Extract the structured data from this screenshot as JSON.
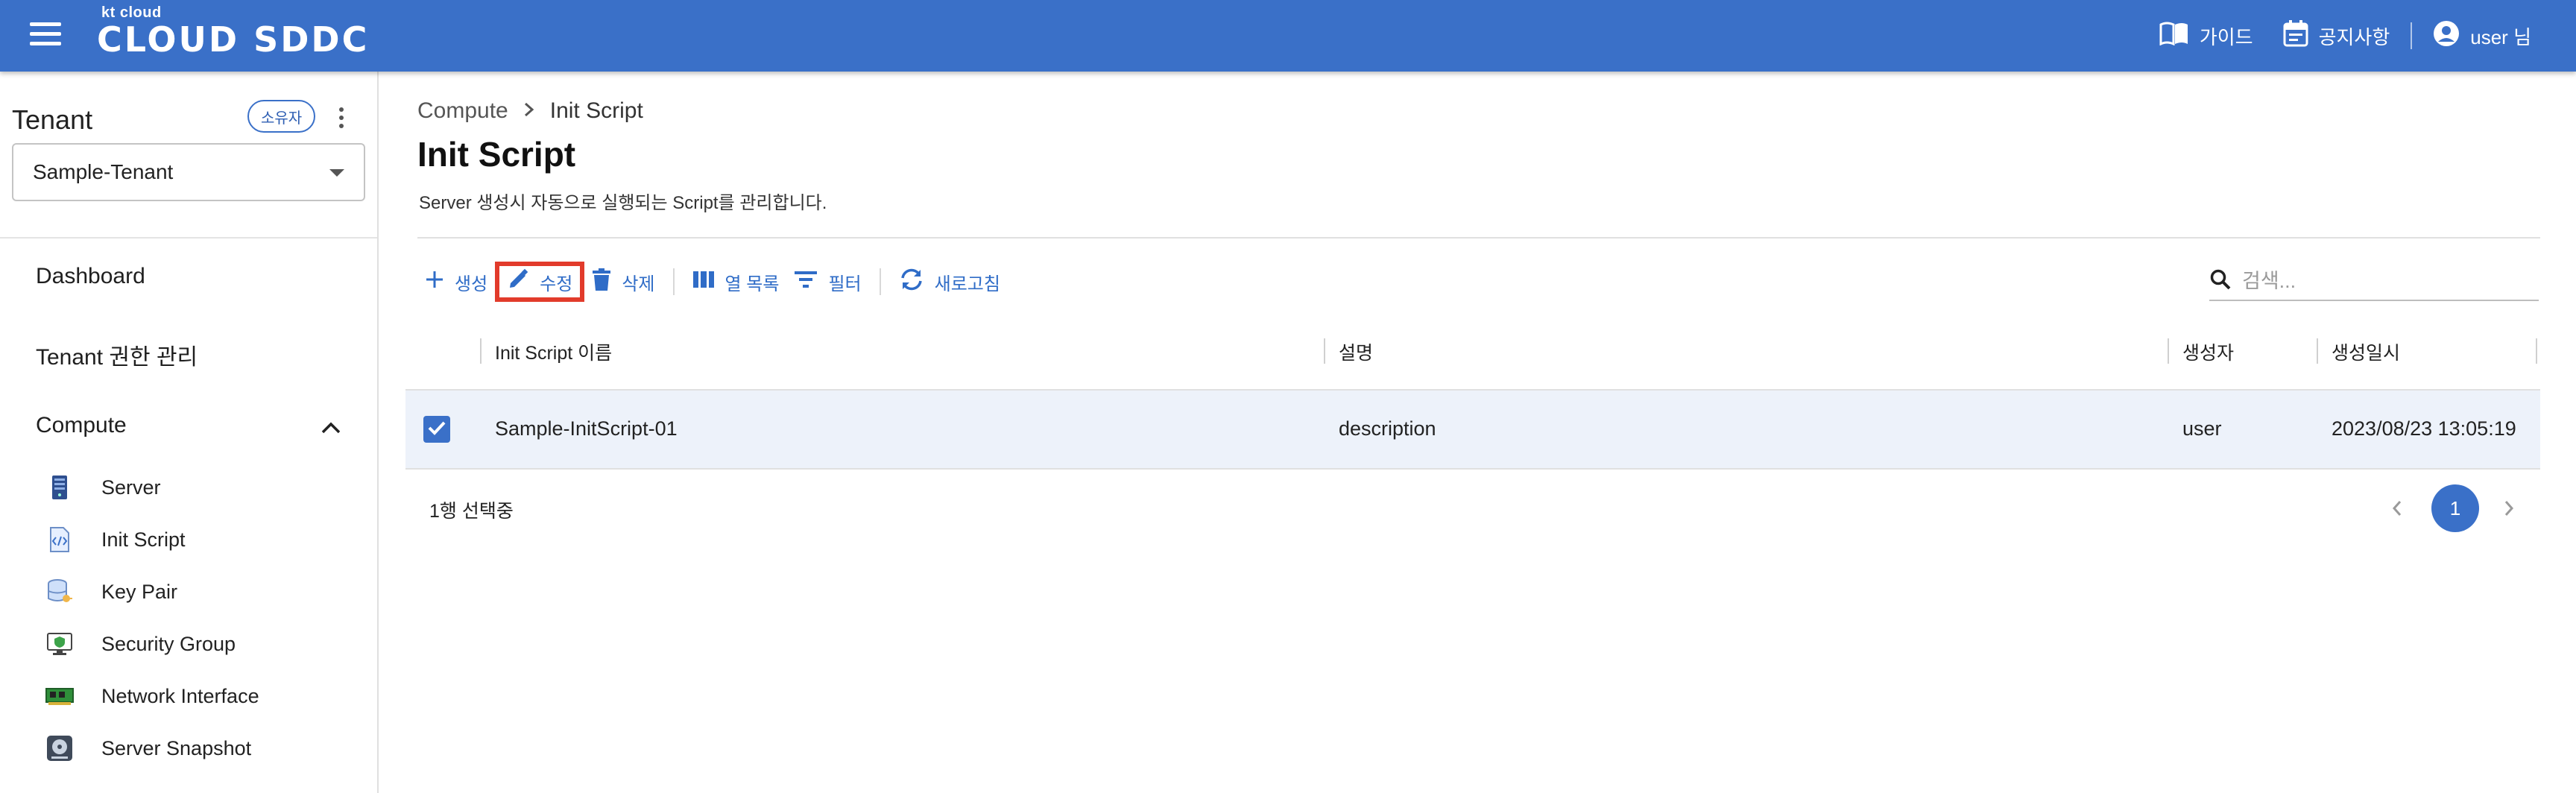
{
  "header": {
    "logo_small": "kt cloud",
    "logo_big": "CLOUD SDDC",
    "guide_label": "가이드",
    "notice_label": "공지사항",
    "user_label": "user 님"
  },
  "sidebar": {
    "tenant_title": "Tenant",
    "owner_badge": "소유자",
    "tenant_selected": "Sample-Tenant",
    "nav": {
      "dashboard": "Dashboard",
      "tenant_permissions": "Tenant 권한 관리",
      "compute": "Compute"
    },
    "compute_items": [
      {
        "label": "Server",
        "icon": "server-icon"
      },
      {
        "label": "Init Script",
        "icon": "script-file-icon"
      },
      {
        "label": "Key Pair",
        "icon": "key-database-icon"
      },
      {
        "label": "Security Group",
        "icon": "monitor-shield-icon"
      },
      {
        "label": "Network Interface",
        "icon": "network-card-icon"
      },
      {
        "label": "Server Snapshot",
        "icon": "disk-snapshot-icon"
      }
    ]
  },
  "main": {
    "breadcrumb": [
      "Compute",
      "Init Script"
    ],
    "title": "Init Script",
    "description": "Server 생성시 자동으로 실행되는 Script를 관리합니다.",
    "toolbar": {
      "create": "생성",
      "edit": "수정",
      "delete": "삭제",
      "columns": "열 목록",
      "filter": "필터",
      "refresh": "새로고침"
    },
    "search_placeholder": "검색...",
    "table": {
      "columns": [
        "Init Script 이름",
        "설명",
        "생성자",
        "생성일시"
      ],
      "rows": [
        {
          "name": "Sample-InitScript-01",
          "description": "description",
          "creator": "user",
          "created_at": "2023/08/23 13:05:19",
          "selected": true
        }
      ]
    },
    "selected_count": "1행 선택중",
    "pagination": {
      "current_page": "1"
    }
  },
  "colors": {
    "brand": "#3a70c8",
    "accent_link": "#2f6cc7",
    "highlight": "#e23b2b",
    "row_selected": "#edf2fa"
  }
}
